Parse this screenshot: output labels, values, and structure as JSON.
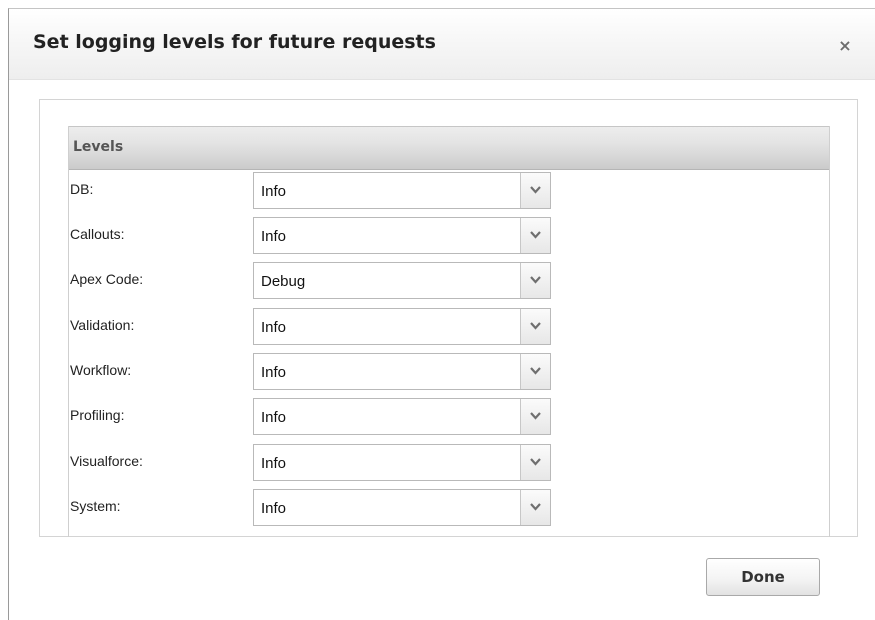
{
  "dialog": {
    "title": "Set logging levels for future requests",
    "close_label": "×",
    "done_label": "Done"
  },
  "levels": {
    "section_title": "Levels",
    "rows": [
      {
        "label": "DB:",
        "value": "Info"
      },
      {
        "label": "Callouts:",
        "value": "Info"
      },
      {
        "label": "Apex Code:",
        "value": "Debug"
      },
      {
        "label": "Validation:",
        "value": "Info"
      },
      {
        "label": "Workflow:",
        "value": "Info"
      },
      {
        "label": "Profiling:",
        "value": "Info"
      },
      {
        "label": "Visualforce:",
        "value": "Info"
      },
      {
        "label": "System:",
        "value": "Info"
      }
    ]
  },
  "icons": {
    "close": "close-icon",
    "dropdown": "chevron-down-icon"
  }
}
